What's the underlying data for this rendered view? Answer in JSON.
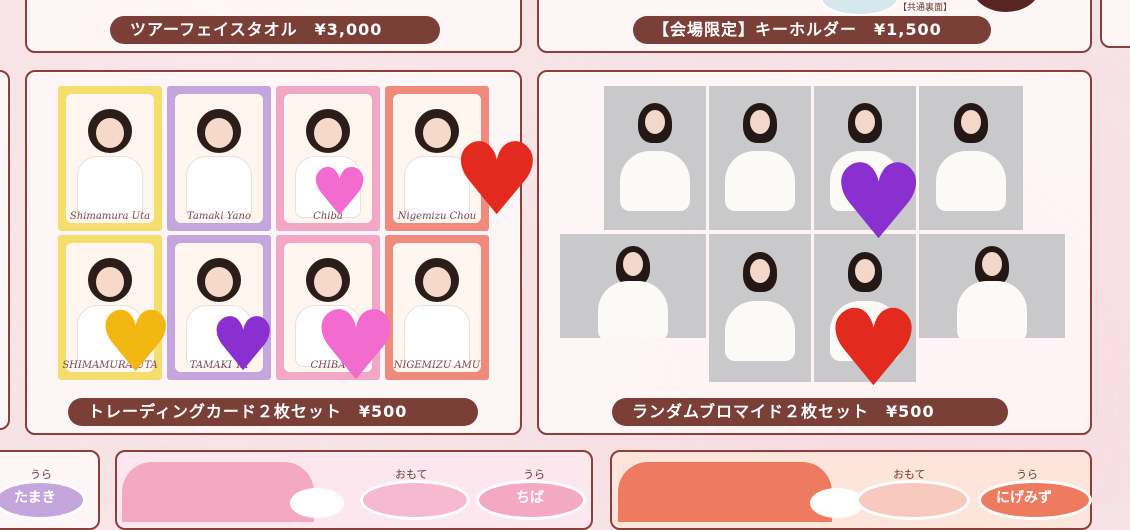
{
  "top_panels": {
    "towel_label": "ツアーフェイスタオル　¥3,000",
    "keyholder_label": "【会場限定】キーホルダー　¥1,500",
    "keyholder_note": "【共通裏面】"
  },
  "trading_cards": {
    "label": "トレーディングカード２枚セット　¥500",
    "cards": [
      {
        "name": "Shimamura Uta",
        "color": "#f3de6e"
      },
      {
        "name": "Tamaki Yano",
        "color": "#c4a6dd"
      },
      {
        "name": "Chiba",
        "color": "#f2a7c6"
      },
      {
        "name": "Nigemizu Chou",
        "color": "#f08a7c"
      },
      {
        "name": "SHIMAMURA UTA",
        "color": "#f3de6e"
      },
      {
        "name": "TAMAKI YA",
        "color": "#c4a6dd"
      },
      {
        "name": "CHIBA",
        "color": "#f2a7c6"
      },
      {
        "name": "NIGEMIZU AMU",
        "color": "#f08a7c"
      }
    ]
  },
  "bromide": {
    "label": "ランダムブロマイド２枚セット　¥500"
  },
  "bottom": {
    "ura_1": "うら",
    "tamaki": "たまき",
    "omote_1": "おもて",
    "ura_2": "うら",
    "chiba": "ちば",
    "omote_2": "おもて",
    "ura_3": "うら",
    "nigemizu": "にげみず"
  },
  "colors": {
    "border": "#8a3f3a",
    "label_bg": "#7a3f37",
    "pink_shirt": "#f4a9c3",
    "orange_shirt": "#ee7a5f"
  }
}
